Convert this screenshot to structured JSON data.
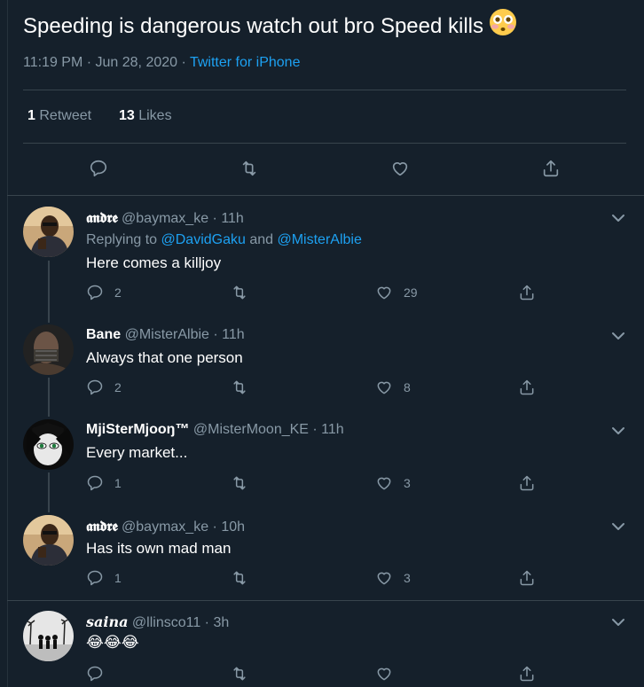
{
  "main_tweet": {
    "text": "Speeding is dangerous watch out bro Speed kills",
    "emoji": "flushed-face",
    "time": "11:19 PM · Jun 28, 2020 · ",
    "source": "Twitter for iPhone",
    "retweet_count": "1",
    "retweet_label": "Retweet",
    "like_count": "13",
    "like_label": "Likes"
  },
  "replies": [
    {
      "name": "𝖆𝖓𝖉𝖗𝖊",
      "handle": "@baymax_ke · 11h",
      "replying_prefix": "Replying to ",
      "mention1": "@DavidGaku",
      "mention_join": " and ",
      "mention2": "@MisterAlbie",
      "text": "Here comes a killjoy",
      "reply_count": "2",
      "like_count": "29"
    },
    {
      "name": "Bane",
      "handle": "@MisterAlbie · 11h",
      "text": "Always that one person",
      "reply_count": "2",
      "like_count": "8"
    },
    {
      "name": "MjiSterMjooŋ™",
      "handle": "@MisterMoon_KE · 11h",
      "text": "Every market...",
      "reply_count": "1",
      "like_count": "3"
    },
    {
      "name": "𝖆𝖓𝖉𝖗𝖊",
      "handle": "@baymax_ke · 10h",
      "text": "Has its own mad man",
      "reply_count": "1",
      "like_count": "3"
    },
    {
      "name": "saina",
      "handle": "@llinsco11 · 3h",
      "text": "😂😂😂",
      "reply_count": "",
      "like_count": ""
    }
  ],
  "colors": {
    "background": "#15202b",
    "secondary_text": "#8899a6",
    "accent": "#1da1f2",
    "divider": "#38444d"
  }
}
